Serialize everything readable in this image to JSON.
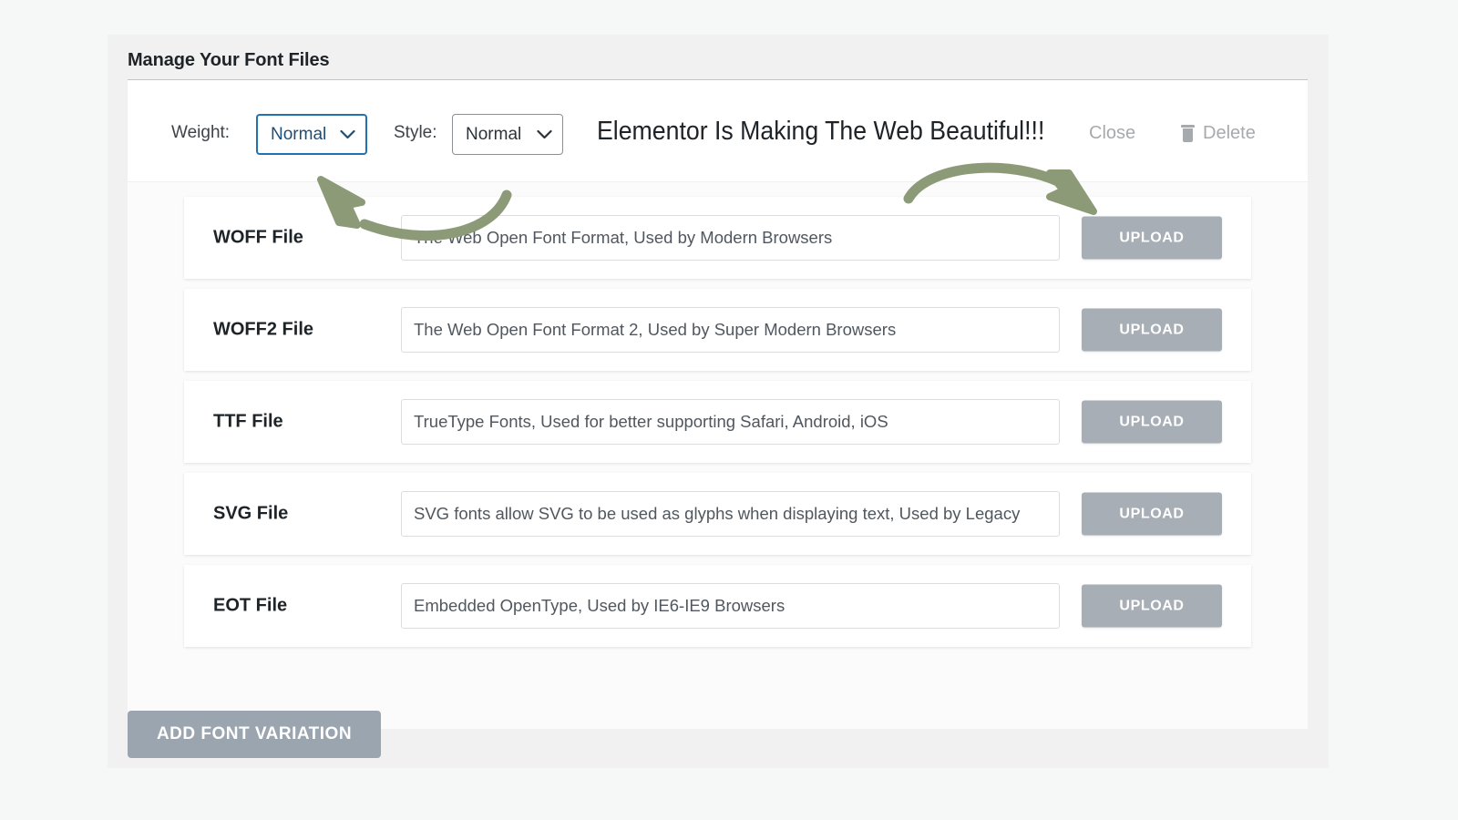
{
  "panel": {
    "title": "Manage Your Font Files"
  },
  "variation_header": {
    "weight_label": "Weight:",
    "weight_value": "Normal",
    "style_label": "Style:",
    "style_value": "Normal",
    "preview_text": "Elementor Is Making The Web Beautiful!!!",
    "close_label": "Close",
    "delete_label": "Delete",
    "delete_icon": "trash-icon",
    "caret_icon": "chevron-down-icon"
  },
  "file_rows": [
    {
      "label": "WOFF File",
      "placeholder": "The Web Open Font Format, Used by Modern Browsers",
      "value": "",
      "upload_label": "UPLOAD"
    },
    {
      "label": "WOFF2 File",
      "placeholder": "The Web Open Font Format 2, Used by Super Modern Browsers",
      "value": "",
      "upload_label": "UPLOAD"
    },
    {
      "label": "TTF File",
      "placeholder": "TrueType Fonts, Used for better supporting Safari, Android, iOS",
      "value": "",
      "upload_label": "UPLOAD"
    },
    {
      "label": "SVG File",
      "placeholder": "SVG fonts allow SVG to be used as glyphs when displaying text, Used by Legacy",
      "value": "",
      "upload_label": "UPLOAD"
    },
    {
      "label": "EOT File",
      "placeholder": "Embedded OpenType, Used by IE6-IE9 Browsers",
      "value": "",
      "upload_label": "UPLOAD"
    }
  ],
  "footer": {
    "add_variation_label": "ADD FONT VARIATION"
  },
  "annotations": {
    "arrow_color": "#8c9a78",
    "left_arrow_name": "annotation-arrow-to-weight-dropdown",
    "right_arrow_name": "annotation-arrow-to-upload-button"
  },
  "colors": {
    "page_background": "#f6f7f7",
    "panel_background": "#f1f1f1",
    "card_background": "#ffffff",
    "rows_background": "#fafbfa",
    "focus_blue": "#2271b1",
    "button_gray": "#a7aeb5",
    "add_button_gray": "#9ba5af",
    "muted_text": "#a7aaad",
    "annotation_green": "#8c9a78"
  }
}
